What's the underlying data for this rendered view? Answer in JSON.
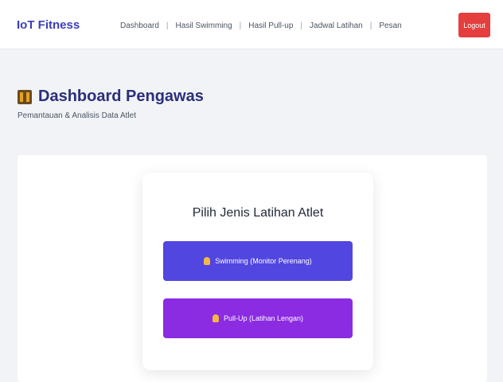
{
  "navbar": {
    "brand": "IoT Fitness",
    "links": [
      "Dashboard",
      "Hasil Swimming",
      "Hasil Pull-up",
      "Jadwal Latihan",
      "Pesan"
    ],
    "logout_label": "Logout"
  },
  "header": {
    "title": "Dashboard Pengawas",
    "subtitle": "Pemantauan & Analisis Data Atlet"
  },
  "selector": {
    "title": "Pilih Jenis Latihan Atlet",
    "options": [
      {
        "label": "Swimming (Monitor Perenang)",
        "color": "#5146e0"
      },
      {
        "label": "Pull-Up (Latihan Lengan)",
        "color": "#8b2be2"
      }
    ]
  },
  "colors": {
    "brand": "#3b3fb8",
    "logout": "#e53e3e"
  },
  "icons": {
    "title": "castle-icon",
    "options": [
      "swimmer-icon",
      "muscle-icon"
    ]
  }
}
